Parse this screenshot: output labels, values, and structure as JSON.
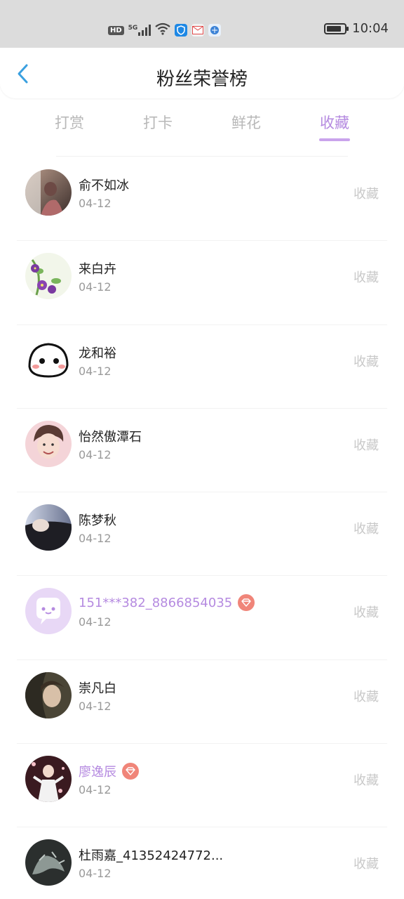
{
  "status_bar": {
    "left_icons": [
      "hd-icon",
      "5g-signal-icon",
      "wifi-icon",
      "shield-app-icon",
      "mail-app-icon",
      "browser-app-icon"
    ],
    "hd_label": "HD",
    "network_label": "5G",
    "battery_level": 0.85,
    "time": "10:04"
  },
  "header": {
    "title": "粉丝荣誉榜",
    "back_icon": "chevron-left-icon"
  },
  "tabs": [
    {
      "label": "打赏",
      "active": false
    },
    {
      "label": "打卡",
      "active": false
    },
    {
      "label": "鲜花",
      "active": false
    },
    {
      "label": "收藏",
      "active": true
    }
  ],
  "colors": {
    "accent": "#b58ae0",
    "underline": "#c9a3ec",
    "status_bar_bg": "#dcdcdc",
    "vip_badge": "#f08579",
    "muted_text": "#c8c8c8",
    "back_arrow": "#3aa0e0"
  },
  "fans": [
    {
      "name": "俞不如冰",
      "date": "04-12",
      "action": "收藏",
      "vip": false
    },
    {
      "name": "来白卉",
      "date": "04-12",
      "action": "收藏",
      "vip": false
    },
    {
      "name": "龙和裕",
      "date": "04-12",
      "action": "收藏",
      "vip": false
    },
    {
      "name": "怡然傲潭石",
      "date": "04-12",
      "action": "收藏",
      "vip": false
    },
    {
      "name": "陈梦秋",
      "date": "04-12",
      "action": "收藏",
      "vip": false
    },
    {
      "name": "151***382_8866854035",
      "date": "04-12",
      "action": "收藏",
      "vip": true
    },
    {
      "name": "崇凡白",
      "date": "04-12",
      "action": "收藏",
      "vip": false
    },
    {
      "name": "廖逸辰",
      "date": "04-12",
      "action": "收藏",
      "vip": true
    },
    {
      "name": "杜雨嘉_41352424772...",
      "date": "04-12",
      "action": "收藏",
      "vip": false
    }
  ]
}
